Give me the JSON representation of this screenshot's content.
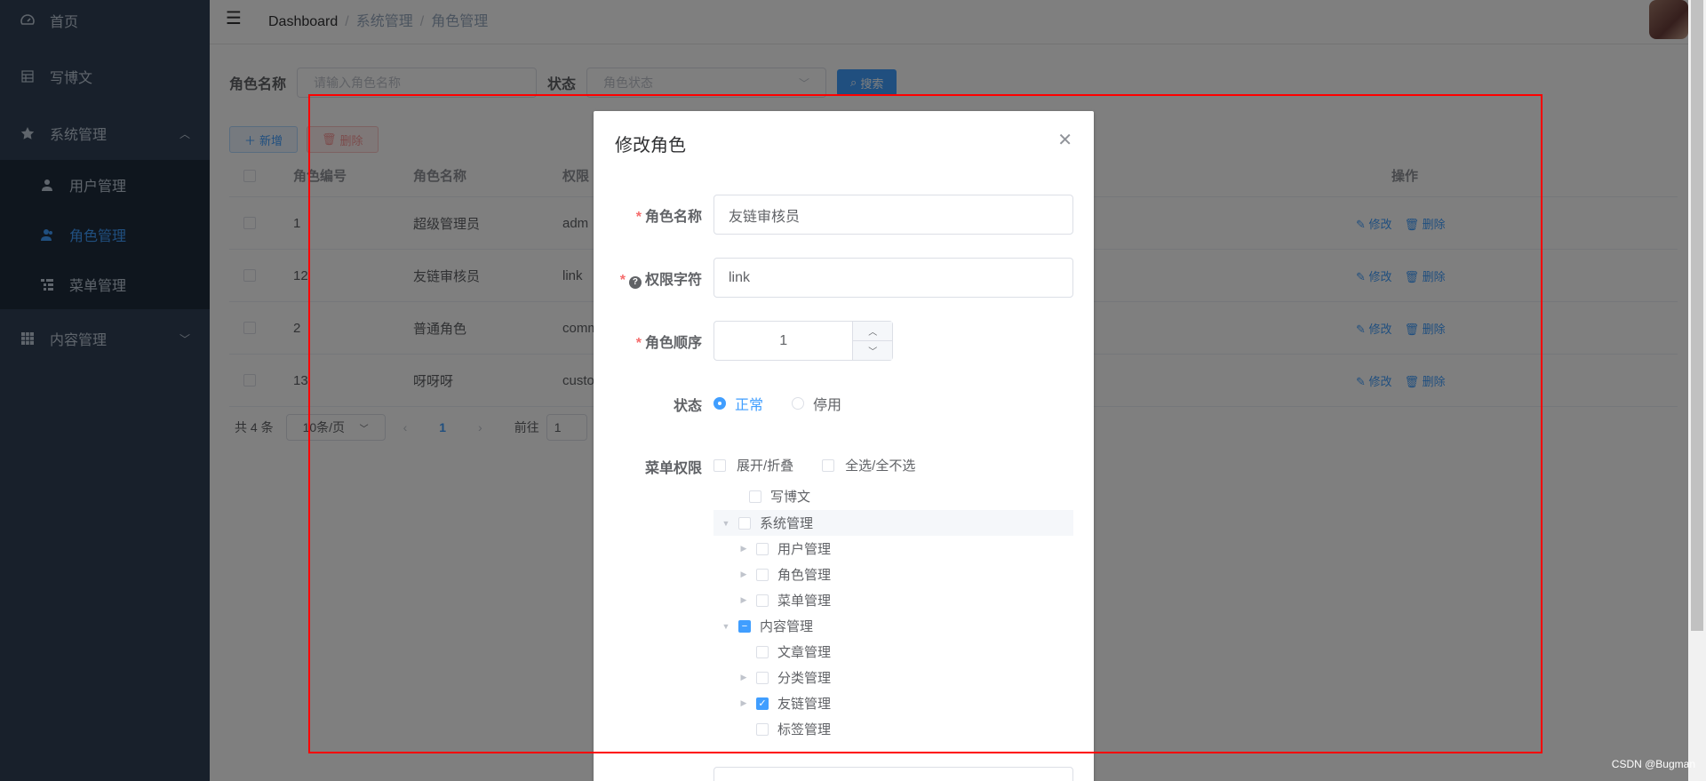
{
  "sidebar": {
    "items": [
      {
        "label": "首页",
        "icon": "dashboard-icon"
      },
      {
        "label": "写博文",
        "icon": "table-icon"
      },
      {
        "label": "系统管理",
        "icon": "star-icon",
        "expanded": true
      },
      {
        "label": "用户管理",
        "icon": "user-icon"
      },
      {
        "label": "角色管理",
        "icon": "peoples-icon",
        "active": true
      },
      {
        "label": "菜单管理",
        "icon": "tree-table-icon"
      },
      {
        "label": "内容管理",
        "icon": "grid-icon"
      }
    ]
  },
  "header": {
    "breadcrumb": [
      "Dashboard",
      "系统管理",
      "角色管理"
    ]
  },
  "search": {
    "role_name_label": "角色名称",
    "role_name_placeholder": "请输入角色名称",
    "status_label": "状态",
    "status_placeholder": "角色状态",
    "search_button": "搜索"
  },
  "toolbar": {
    "add_label": "新增",
    "delete_label": "删除"
  },
  "table": {
    "headers": {
      "id": "角色编号",
      "name": "角色名称",
      "key": "权限",
      "ops": "操作"
    },
    "rows": [
      {
        "id": "1",
        "name": "超级管理员",
        "key": "adm"
      },
      {
        "id": "12",
        "name": "友链审核员",
        "key": "link"
      },
      {
        "id": "2",
        "name": "普通角色",
        "key": "comm"
      },
      {
        "id": "13",
        "name": "呀呀呀",
        "key": "custo"
      }
    ],
    "edit_label": "修改",
    "delete_label": "删除"
  },
  "pagination": {
    "total": "共 4 条",
    "page_size": "10条/页",
    "current": "1",
    "goto_label": "前往",
    "goto_value": "1"
  },
  "dialog": {
    "title": "修改角色",
    "role_name_label": "角色名称",
    "role_name_value": "友链审核员",
    "role_key_label": "权限字符",
    "role_key_value": "link",
    "role_sort_label": "角色顺序",
    "role_sort_value": "1",
    "status_label": "状态",
    "status_normal": "正常",
    "status_disabled": "停用",
    "menu_perm_label": "菜单权限",
    "expand_collapse": "展开/折叠",
    "select_all": "全选/全不选",
    "tree": [
      {
        "label": "写博文",
        "level": 0,
        "caret": "",
        "state": "unchecked"
      },
      {
        "label": "系统管理",
        "level": 0,
        "caret": "down",
        "state": "unchecked"
      },
      {
        "label": "用户管理",
        "level": 1,
        "caret": "right",
        "state": "unchecked"
      },
      {
        "label": "角色管理",
        "level": 1,
        "caret": "right",
        "state": "unchecked"
      },
      {
        "label": "菜单管理",
        "level": 1,
        "caret": "right",
        "state": "unchecked"
      },
      {
        "label": "内容管理",
        "level": 0,
        "caret": "down",
        "state": "indeterminate"
      },
      {
        "label": "文章管理",
        "level": 1,
        "caret": "",
        "state": "unchecked"
      },
      {
        "label": "分类管理",
        "level": 1,
        "caret": "right",
        "state": "unchecked"
      },
      {
        "label": "友链管理",
        "level": 1,
        "caret": "right",
        "state": "checked"
      },
      {
        "label": "标签管理",
        "level": 1,
        "caret": "",
        "state": "unchecked"
      }
    ]
  },
  "watermark": "CSDN @Bugman",
  "colors": {
    "primary": "#409eff",
    "sidebar_bg": "#304156",
    "danger": "#f56c6c"
  }
}
